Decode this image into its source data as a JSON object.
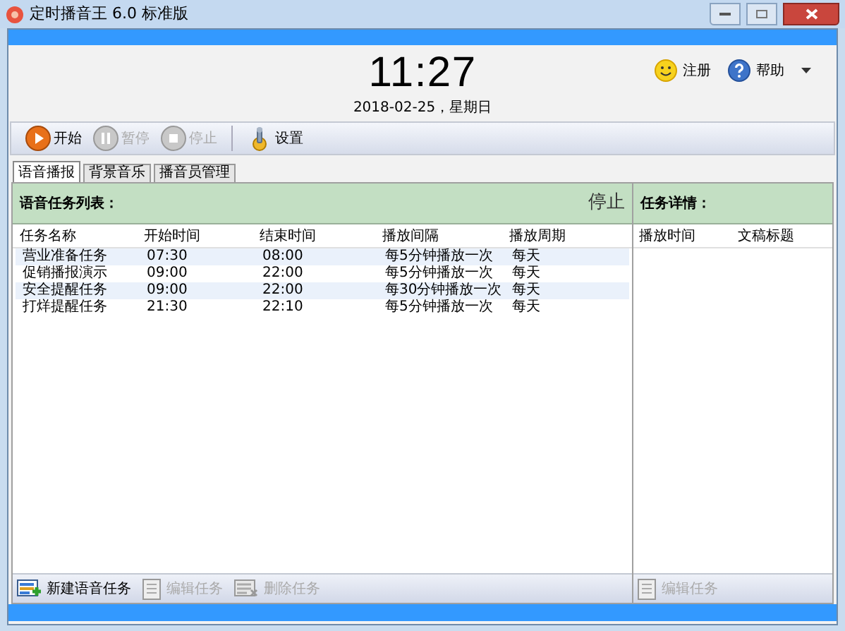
{
  "window": {
    "title": "定时播音王 6.0 标准版"
  },
  "clock": {
    "time": "11:27",
    "date": "2018-02-25，星期日"
  },
  "header_links": [
    {
      "kind": "smile",
      "label": "注册"
    },
    {
      "kind": "help",
      "label": "帮助"
    }
  ],
  "toolbar": [
    {
      "kind": "play",
      "label": "开始",
      "disabled": false
    },
    {
      "kind": "pause",
      "label": "暂停",
      "disabled": true
    },
    {
      "kind": "stop",
      "label": "停止",
      "disabled": true
    },
    {
      "kind": "settings",
      "label": "设置",
      "disabled": false
    }
  ],
  "tabs": [
    {
      "label": "语音播报",
      "selected": true
    },
    {
      "label": "背景音乐",
      "selected": false
    },
    {
      "label": "播音员管理",
      "selected": false
    }
  ],
  "task_list": {
    "title": "语音任务列表：",
    "status": "停止",
    "columns": [
      "任务名称",
      "开始时间",
      "结束时间",
      "播放间隔",
      "播放周期"
    ],
    "rows": [
      [
        "营业准备任务",
        "07:30",
        "08:00",
        "每5分钟播放一次",
        "每天"
      ],
      [
        "促销播报演示",
        "09:00",
        "22:00",
        "每5分钟播放一次",
        "每天"
      ],
      [
        "安全提醒任务",
        "09:00",
        "22:00",
        "每30分钟播放一次",
        "每天"
      ],
      [
        "打烊提醒任务",
        "21:30",
        "22:10",
        "每5分钟播放一次",
        "每天"
      ]
    ],
    "actions": [
      {
        "kind": "add",
        "label": "新建语音任务",
        "disabled": false
      },
      {
        "kind": "edit",
        "label": "编辑任务",
        "disabled": true
      },
      {
        "kind": "delete",
        "label": "删除任务",
        "disabled": true
      }
    ]
  },
  "details": {
    "title": "任务详情：",
    "columns": [
      "播放时间",
      "文稿标题"
    ],
    "actions": [
      {
        "kind": "edit",
        "label": "编辑任务",
        "disabled": true
      }
    ]
  }
}
